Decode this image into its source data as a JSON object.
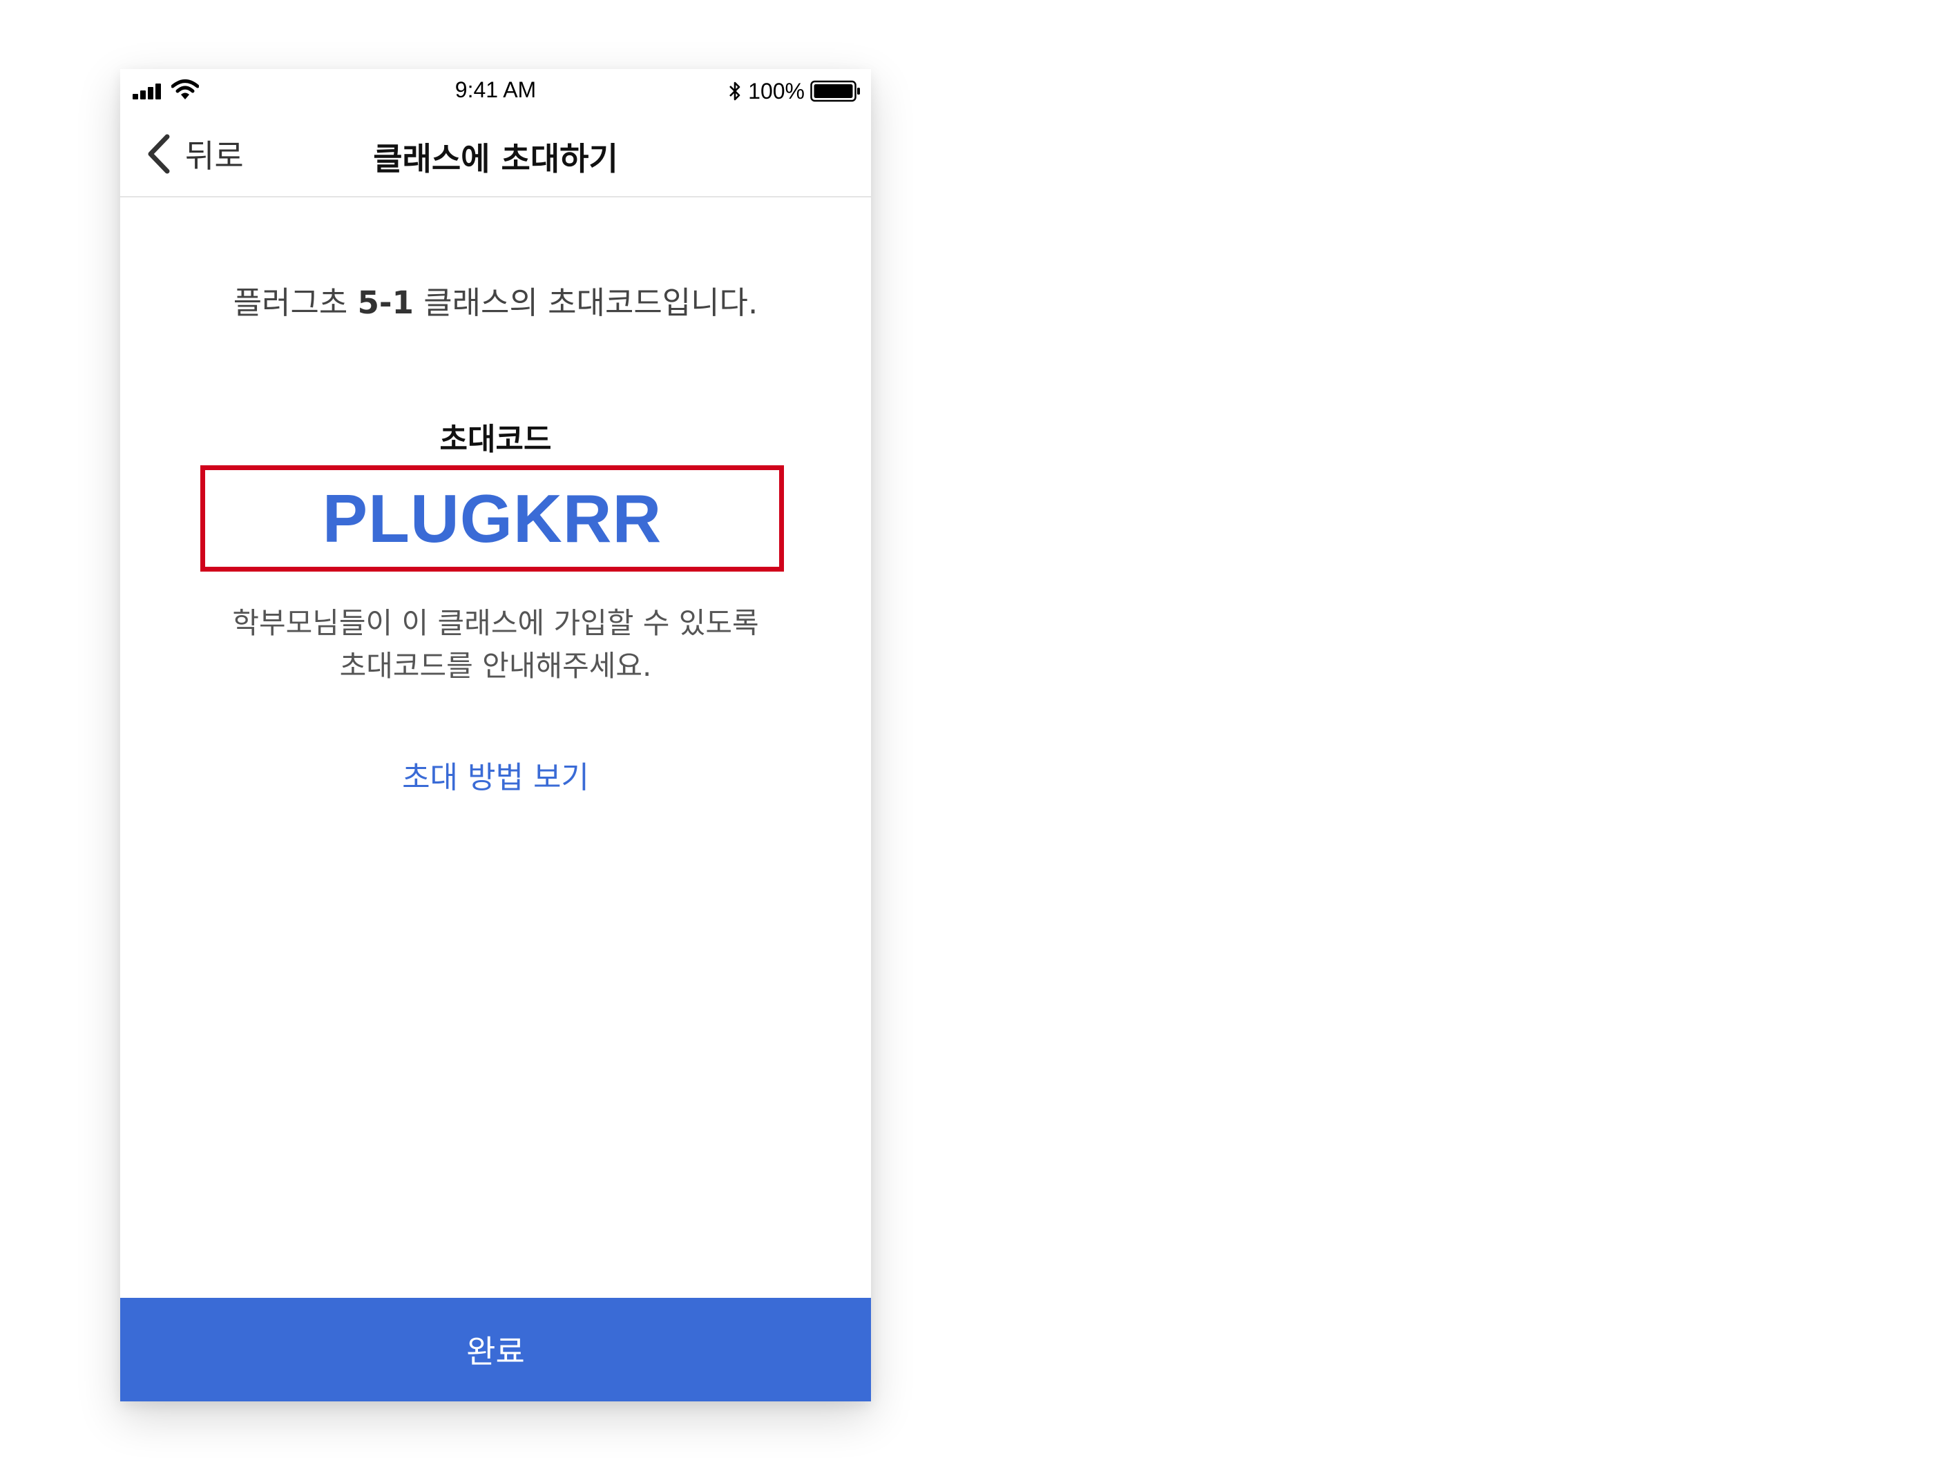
{
  "status_bar": {
    "time": "9:41 AM",
    "battery": "100%"
  },
  "nav": {
    "back_label": "뒤로",
    "title": "클래스에 초대하기"
  },
  "content": {
    "class_desc_prefix": "플러그초 ",
    "class_name": "5-1",
    "class_desc_suffix": " 클래스의 초대코드입니다.",
    "code_label": "초대코드",
    "invite_code": "PLUGKRR",
    "hint_line1": "학부모님들이 이 클래스에 가입할 수 있도록",
    "hint_line2": "초대코드를 안내해주세요.",
    "how_link": "초대 방법 보기"
  },
  "footer": {
    "done_label": "완료"
  },
  "colors": {
    "accent": "#3a6bd6",
    "highlight_border": "#d0021b"
  },
  "icons": [
    "cellular-signal-icon",
    "wifi-icon",
    "bluetooth-icon",
    "battery-icon",
    "chevron-left-icon"
  ]
}
